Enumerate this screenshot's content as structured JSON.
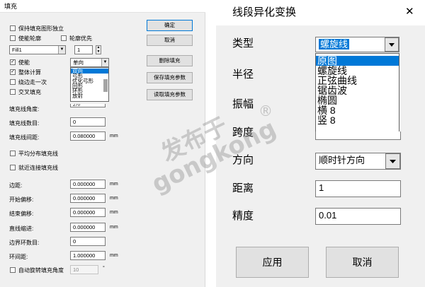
{
  "left": {
    "title": "填充",
    "checkboxes": {
      "keep_independent": "保持填充图形独立",
      "enable_contour": "使能轮廓",
      "contour_first": "轮廓优先",
      "enable": "使能",
      "whole_calc": "整体计算",
      "edge_once": "绕边走一次",
      "cross_fill": "交叉填充",
      "even_distribute": "平均分布填充线",
      "nearby_connect": "就近连接填充线",
      "auto_rotate": "自动旋转填充角度"
    },
    "fill_select": "Fill1",
    "spin_value": "1",
    "mode_select": "单向",
    "mode_options": [
      "双向",
      "弓形",
      "优化弓形",
      "回形",
      "环形",
      "放射"
    ],
    "fields": {
      "angle_label": "填充线角度:",
      "angle_value": "270",
      "count_label": "填充线数目:",
      "count_value": "0",
      "spacing_label": "填充线间距:",
      "spacing_value": "0.080000",
      "margin_label": "边距:",
      "margin_value": "0.000000",
      "start_offset_label": "开始偏移:",
      "start_offset_value": "0.000000",
      "end_offset_label": "结束偏移:",
      "end_offset_value": "0.000000",
      "line_shrink_label": "直线缩进:",
      "line_shrink_value": "0.000000",
      "border_rings_label": "边界环数目:",
      "border_rings_value": "0",
      "ring_spacing_label": "环间距:",
      "ring_spacing_value": "1.000000",
      "rotate_value": "10"
    },
    "unit_mm": "mm",
    "unit_deg": "°",
    "buttons": {
      "ok": "确定",
      "cancel": "取消",
      "delete_fill": "删除填充",
      "save_params": "保存填充参数",
      "read_params": "读取填充参数"
    }
  },
  "watermark": {
    "cn": "发布于",
    "en": "gongkong",
    "reg": "®"
  },
  "right": {
    "title": "线段异化变换",
    "close_glyph": "✕",
    "labels": {
      "type": "类型",
      "radius": "半径",
      "amplitude": "振幅",
      "span": "跨度",
      "direction": "方向",
      "distance": "距离",
      "precision": "精度"
    },
    "type_value": "螺旋线",
    "type_options": [
      "原图",
      "螺旋线",
      "正弦曲线",
      "锯齿波",
      "椭圆",
      "横 8",
      "竖 8"
    ],
    "direction_value": "顺时针方向",
    "distance_value": "1",
    "precision_value": "0.01",
    "apply_button": "应用",
    "cancel_button": "取消"
  }
}
